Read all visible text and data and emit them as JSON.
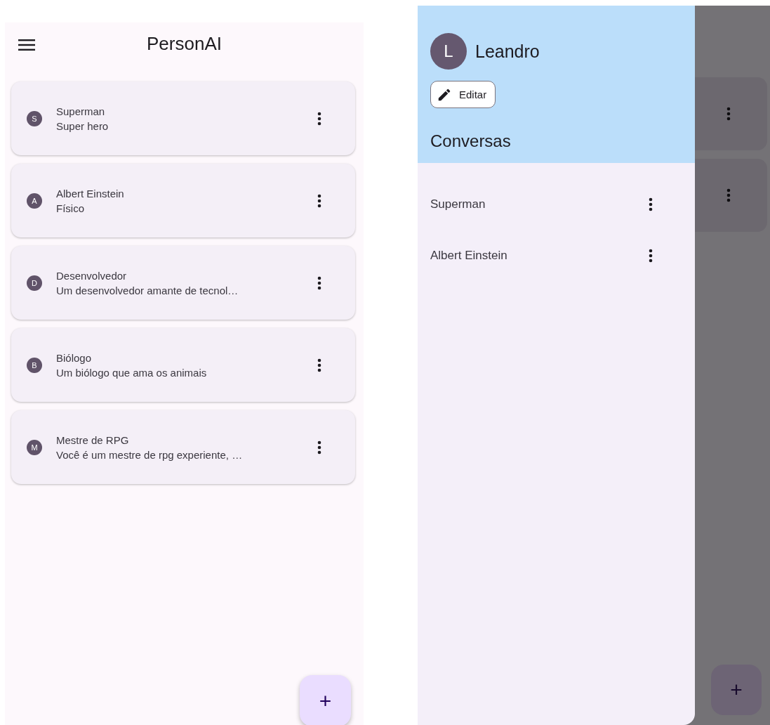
{
  "app_bar": {
    "title": "PersonAI"
  },
  "characters": [
    {
      "initial": "S",
      "name": "Superman",
      "description": "Super hero"
    },
    {
      "initial": "A",
      "name": "Albert Einstein",
      "description": "Físico"
    },
    {
      "initial": "D",
      "name": "Desenvolvedor",
      "description": "Um desenvolvedor amante de tecnol…"
    },
    {
      "initial": "B",
      "name": "Biólogo",
      "description": "Um biólogo que ama os animais"
    },
    {
      "initial": "M",
      "name": "Mestre de RPG",
      "description": "Você é um mestre de rpg experiente, …"
    }
  ],
  "fab": {
    "label": "+"
  },
  "drawer": {
    "user": {
      "initial": "L",
      "name": "Leandro"
    },
    "edit_button": "Editar",
    "section_title": "Conversas",
    "conversations": [
      {
        "name": "Superman"
      },
      {
        "name": "Albert Einstein"
      }
    ]
  },
  "background_fab": {
    "label": "+"
  }
}
